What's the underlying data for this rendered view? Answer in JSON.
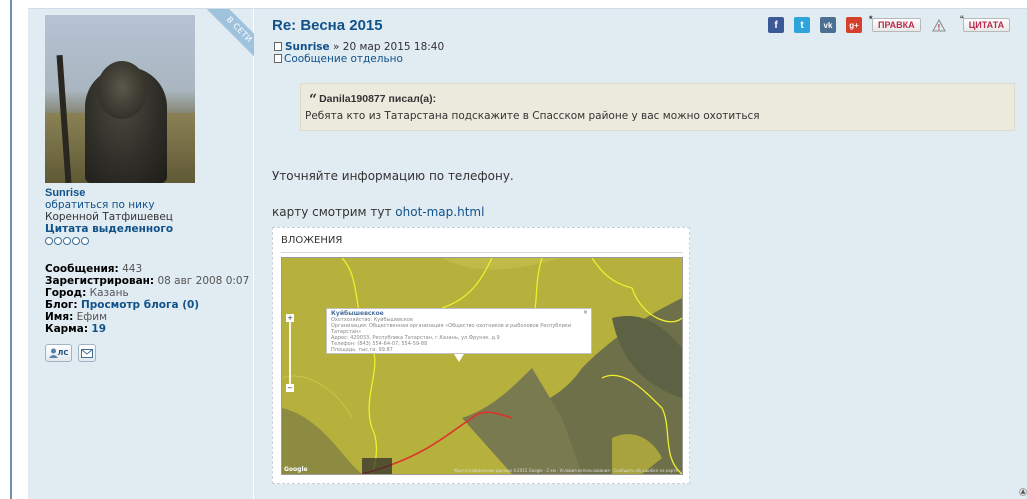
{
  "profile": {
    "online_label": "В СЕТИ",
    "username": "Sunrise",
    "call_by_nick": "обратиться по нику",
    "rank": "Коренной Татфишевец",
    "quote_selected": "Цитата выделенного",
    "stats": {
      "posts_label": "Сообщения:",
      "posts_value": "443",
      "registered_label": "Зарегистрирован:",
      "registered_value": "08 авг 2008 0:07",
      "city_label": "Город:",
      "city_value": "Казань",
      "blog_label": "Блог:",
      "blog_value": "Просмотр блога (0)",
      "name_label": "Имя:",
      "name_value": "Ефим",
      "karma_label": "Карма:",
      "karma_value": "19"
    },
    "pm_button": "ЛС"
  },
  "post": {
    "title": "Re: Весна 2015",
    "author": "Sunrise",
    "date": "» 20 мар 2015 18:40",
    "single_link": "Сообщение отдельно",
    "buttons": {
      "edit": "ПРАВКА",
      "warn": "!",
      "quote": "ЦИТАТА"
    },
    "social": [
      "f",
      "t",
      "vk",
      "g+"
    ],
    "quote": {
      "author": "Danila190877 писал(а):",
      "text": "Ребята кто из Татарстана подскажите в Спасском районе у вас можно охотиться"
    },
    "paragraph1": "Уточняйте информацию по телефону.",
    "paragraph2_prefix": "карту смотрим тут ",
    "paragraph2_link": "ohot-map.html",
    "attachments_heading": "ВЛОЖЕНИЯ",
    "map": {
      "popup_title": "Куйбышевское",
      "popup_lines": [
        "Охотхозяйство: Куйбышевское",
        "Организация: Общественная организация «Общество охотников и рыболовов Республики Татарстан»",
        "Адрес: 420033, Республика Татарстан, г.Казань, ул.Фрунзе, д.9",
        "Телефон: (843) 554-64-07, 554-59-88",
        "Площадь, тыс.га: 99.87"
      ],
      "close": "×",
      "zoom_in": "+",
      "zoom_out": "−",
      "brand": "Google",
      "copyright": "Картографические данные ©2015 Google · 2 км · Условия использования · Сообщить об ошибке на карте"
    }
  },
  "colors": {
    "link": "#105289",
    "post_bg": "#e1ebf2",
    "quote_bg": "#ebeadd",
    "button_text": "#bc2a4d"
  },
  "icons": [
    "facebook-icon",
    "twitter-icon",
    "vk-icon",
    "googleplus-icon",
    "pm-icon",
    "mail-icon",
    "document-icon",
    "scroll-top-icon"
  ]
}
